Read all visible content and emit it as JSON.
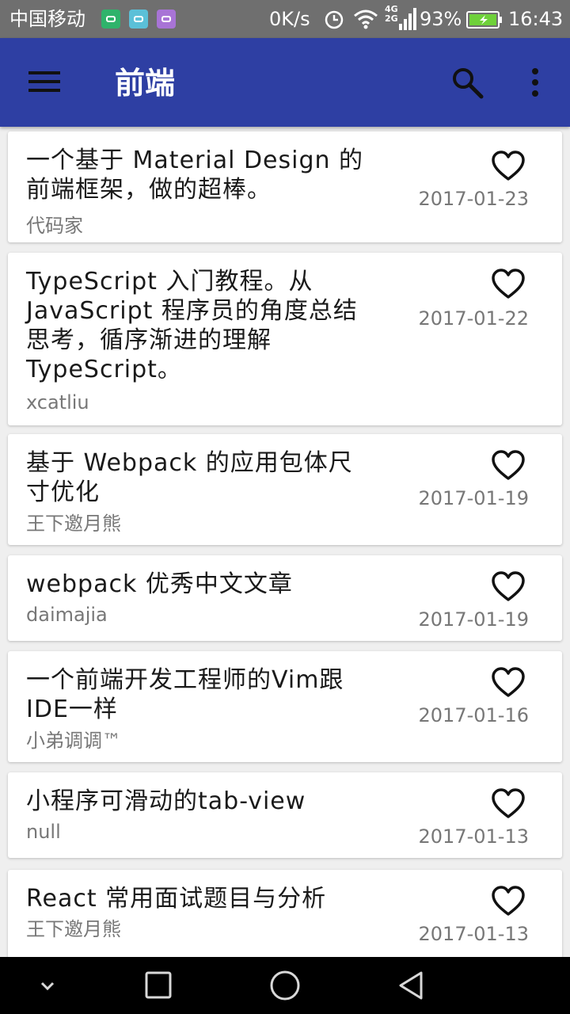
{
  "status_bar": {
    "carrier": "中国移动",
    "speed": "0K/s",
    "network": "4G",
    "network2": "2G",
    "battery": "93%",
    "time": "16:43"
  },
  "app_bar": {
    "title": "前端",
    "icons": [
      "menu-icon",
      "search-icon",
      "more-vert-icon"
    ]
  },
  "articles": [
    {
      "title": "一个基于 Material Design 的前端框架，做的超棒。",
      "author": "代码家",
      "date": "2017-01-23"
    },
    {
      "title": "TypeScript 入门教程。从 JavaScript 程序员的角度总结思考，循序渐进的理解 TypeScript。",
      "author": "xcatliu",
      "date": "2017-01-22"
    },
    {
      "title": "基于 Webpack 的应用包体尺寸优化",
      "author": "王下邀月熊",
      "date": "2017-01-19"
    },
    {
      "title": "webpack 优秀中文文章",
      "author": "daimajia",
      "date": "2017-01-19"
    },
    {
      "title": "一个前端开发工程师的Vim跟IDE一样",
      "author": "小弟调调™",
      "date": "2017-01-16"
    },
    {
      "title": "小程序可滑动的tab-view",
      "author": "null",
      "date": "2017-01-13"
    },
    {
      "title": "React 常用面试题目与分析",
      "author": "王下邀月熊",
      "date": "2017-01-13"
    }
  ],
  "colors": {
    "primary": "#2e3fa3",
    "status_bar": "#6f6f6f",
    "background": "#efefef"
  },
  "nav_bar": [
    "hide-keyboard-icon",
    "recents-icon",
    "home-icon",
    "back-icon"
  ]
}
